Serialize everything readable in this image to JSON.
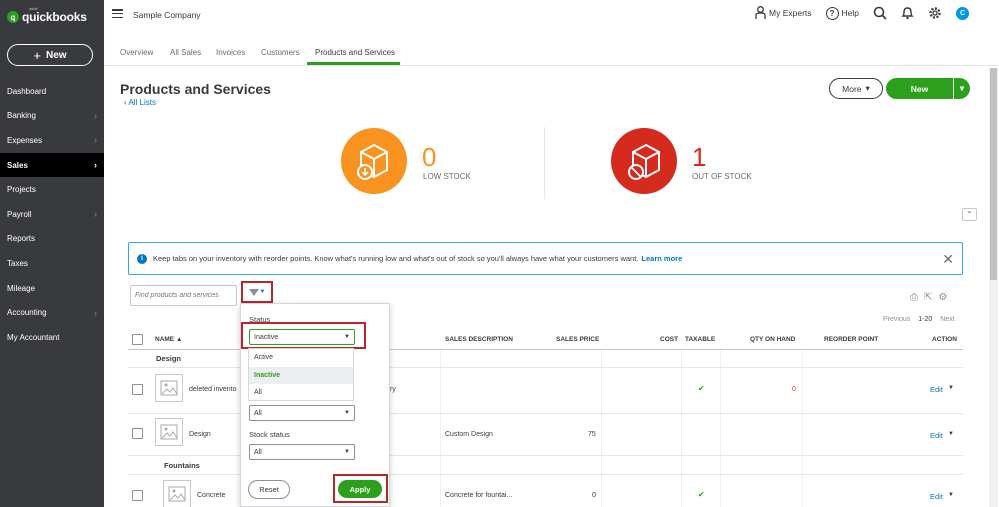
{
  "app": {
    "logo_sup": "intuit",
    "logo_text": "quickbooks",
    "logo_mark": "q"
  },
  "sidebar": {
    "new_label": "New",
    "items": [
      {
        "label": "Dashboard",
        "chev": ""
      },
      {
        "label": "Banking",
        "chev": "›"
      },
      {
        "label": "Expenses",
        "chev": "›"
      },
      {
        "label": "Sales",
        "chev": "›",
        "active": true
      },
      {
        "label": "Projects",
        "chev": ""
      },
      {
        "label": "Payroll",
        "chev": "›"
      },
      {
        "label": "Reports",
        "chev": ""
      },
      {
        "label": "Taxes",
        "chev": ""
      },
      {
        "label": "Mileage",
        "chev": ""
      },
      {
        "label": "Accounting",
        "chev": "›"
      },
      {
        "label": "My Accountant",
        "chev": ""
      }
    ]
  },
  "topbar": {
    "company": "Sample Company",
    "experts": "My Experts",
    "help": "Help",
    "avatar": "C"
  },
  "tabs": [
    "Overview",
    "All Sales",
    "Invoices",
    "Customers",
    "Products and Services"
  ],
  "page": {
    "title": "Products and Services",
    "back_link": "‹ All Lists",
    "more": "More",
    "new": "New"
  },
  "stock": {
    "low_count": "0",
    "low_label": "LOW STOCK",
    "out_count": "1",
    "out_label": "OUT OF STOCK"
  },
  "banner": {
    "text": "Keep tabs on your inventory with reorder points. Know what's running low and what's out of stock so you'll always have what your customers want.",
    "link": "Learn more"
  },
  "search": {
    "placeholder": "Find products and services"
  },
  "pager": {
    "prev": "Previous",
    "range": "1-20",
    "next": "Next"
  },
  "table": {
    "headers": {
      "name": "NAME ▲",
      "sales_desc": "SALES DESCRIPTION",
      "sales_price": "SALES PRICE",
      "cost": "COST",
      "taxable": "TAXABLE",
      "qty": "QTY ON HAND",
      "reorder": "REORDER POINT",
      "action": "ACTION"
    },
    "groups": [
      "Design",
      "Fountains"
    ],
    "rows": [
      {
        "name": "deleted invento",
        "desc_tail": "ry",
        "desc": "",
        "price": "",
        "taxable": "✔",
        "qty": "0",
        "edit": "Edit"
      },
      {
        "name": "Design",
        "desc": "Custom Design",
        "price": "75",
        "taxable": "",
        "qty": "",
        "edit": "Edit"
      },
      {
        "name": "Concrete",
        "desc": "Concrete for fountai...",
        "price": "0",
        "taxable": "✔",
        "qty": "",
        "edit": "Edit"
      }
    ]
  },
  "filter": {
    "status_label": "Status",
    "status_value": "Inactive",
    "options": [
      "Active",
      "Inactive",
      "All"
    ],
    "second_value": "All",
    "stock_label": "Stock status",
    "stock_value": "All",
    "reset": "Reset",
    "apply": "Apply"
  },
  "colors": {
    "brand_green": "#2ca01c",
    "sidebar": "#393a3d",
    "link": "#0077c5",
    "orange": "#f7931e",
    "red": "#d52b1e",
    "highlight": "#b3272d"
  }
}
